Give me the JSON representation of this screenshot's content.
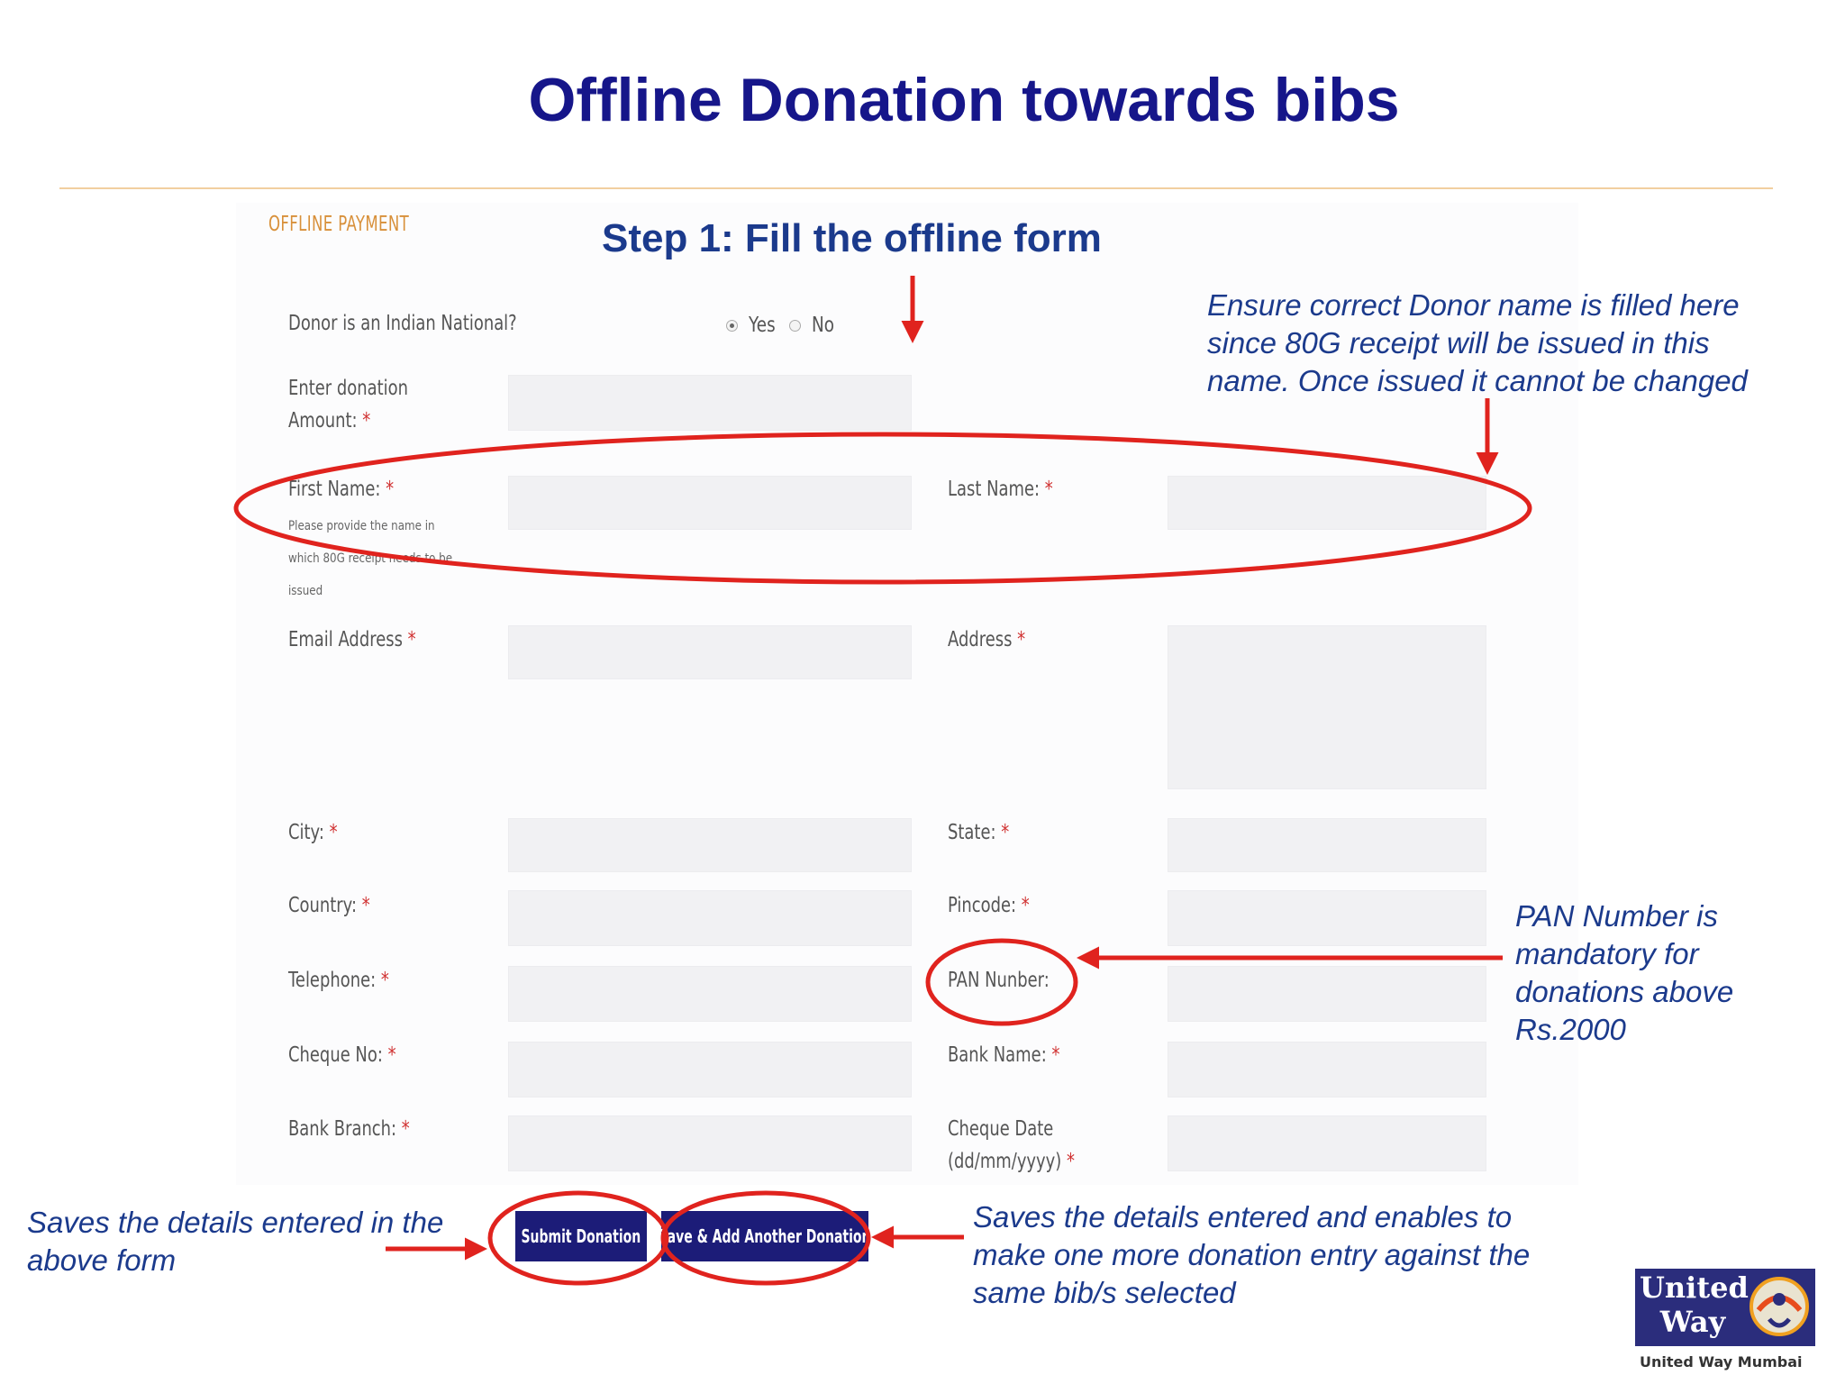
{
  "slide": {
    "title": "Offline Donation towards bibs"
  },
  "form": {
    "section_title": "OFFLINE PAYMENT",
    "step_title": "Step 1: Fill the offline form",
    "indian_national": {
      "label": "Donor is an Indian National?",
      "options": [
        "Yes",
        "No"
      ],
      "selected": "Yes"
    },
    "amount": {
      "label_line1": "Enter donation",
      "label_line2": "Amount:"
    },
    "first_name": {
      "label": "First Name:",
      "hint_line1": "Please provide the name in",
      "hint_line2": "which 80G receipt needs to be",
      "hint_line3": "issued"
    },
    "last_name": {
      "label": "Last Name:"
    },
    "email": {
      "label": "Email Address"
    },
    "address": {
      "label": "Address"
    },
    "city": {
      "label": "City:"
    },
    "state": {
      "label": "State:"
    },
    "country": {
      "label": "Country:"
    },
    "pincode": {
      "label": "Pincode:"
    },
    "telephone": {
      "label": "Telephone:"
    },
    "pan": {
      "label": "PAN Nunber:"
    },
    "cheque_no": {
      "label": "Cheque No:"
    },
    "bank_name": {
      "label": "Bank Name:"
    },
    "bank_branch": {
      "label": "Bank Branch:"
    },
    "cheque_date": {
      "label_line1": "Cheque Date",
      "label_line2": "(dd/mm/yyyy)"
    },
    "required_mark": "*",
    "buttons": {
      "submit": "Submit Donation",
      "save_add": "Save & Add Another Donation"
    }
  },
  "annotations": {
    "donor_name_note": [
      "Ensure correct Donor name is filled here",
      "since 80G receipt will be issued in this",
      "name. Once issued it cannot be changed"
    ],
    "pan_note": [
      "PAN Number is",
      "mandatory for",
      "donations above",
      "Rs.2000"
    ],
    "submit_note": [
      "Saves the details entered in the",
      "above form"
    ],
    "save_add_note": [
      "Saves the details entered and enables to",
      "make one more donation entry against the",
      "same bib/s selected"
    ]
  },
  "logo": {
    "line1": "United",
    "line2": "Way",
    "caption": "United Way Mumbai"
  },
  "colors": {
    "title": "#16168a",
    "annotation_text": "#1b3a8c",
    "annotation_stroke": "#e0231e",
    "button": "#1c1c78",
    "section_title": "#d8903a"
  }
}
